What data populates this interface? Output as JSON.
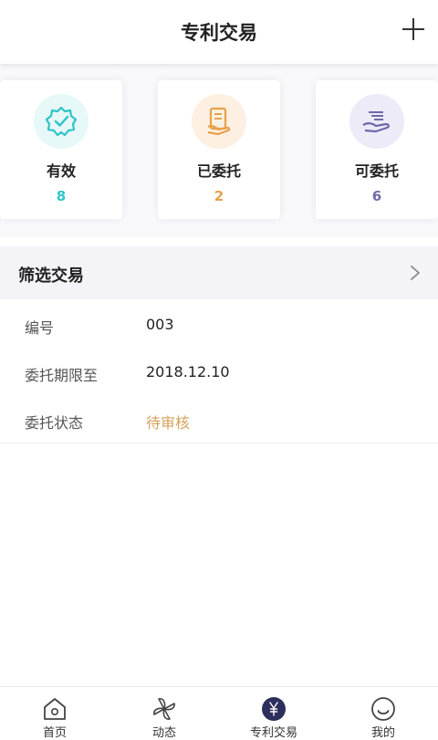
{
  "header": {
    "title": "专利交易",
    "add_icon": "plus-icon"
  },
  "stats": [
    {
      "label": "有效",
      "count": "8",
      "icon": "verified-badge-icon",
      "color": "#2fc3c8",
      "bg": "#e6f8f8"
    },
    {
      "label": "已委托",
      "count": "2",
      "icon": "document-hand-icon",
      "color": "#e7a14a",
      "bg": "#fdf0e2"
    },
    {
      "label": "可委托",
      "count": "6",
      "icon": "hand-offer-icon",
      "color": "#6d6aa9",
      "bg": "#ecebf7"
    }
  ],
  "filter": {
    "title": "筛选交易",
    "chevron_icon": "chevron-right-icon"
  },
  "details": [
    {
      "label": "编号",
      "value": "003"
    },
    {
      "label": "委托期限至",
      "value": "2018.12.10"
    },
    {
      "label": "委托状态",
      "value": "待审核",
      "status_color": "#d4a15a"
    }
  ],
  "tabbar": {
    "tabs": [
      {
        "label": "首页",
        "icon": "home-icon"
      },
      {
        "label": "动态",
        "icon": "pinwheel-icon"
      },
      {
        "label": "专利交易",
        "icon": "yen-circle-icon",
        "active": true
      },
      {
        "label": "我的",
        "icon": "smiley-icon"
      }
    ]
  }
}
